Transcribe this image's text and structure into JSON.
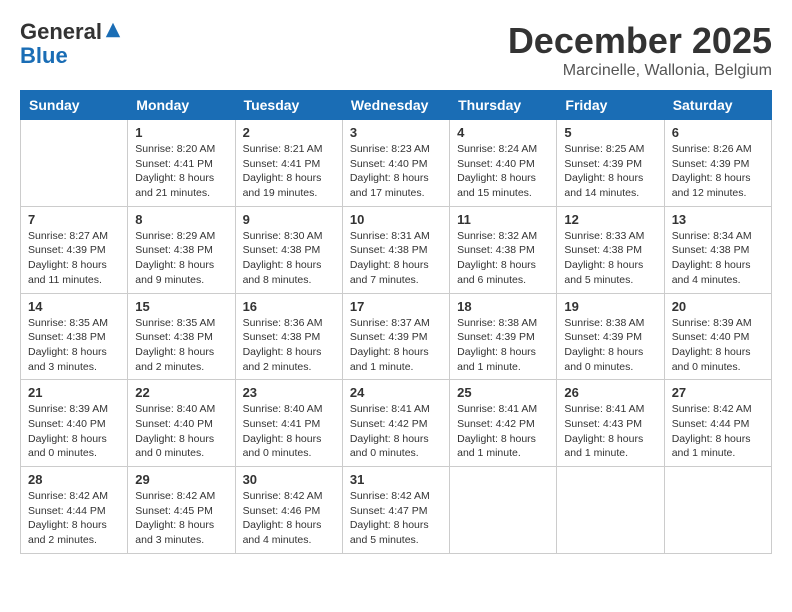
{
  "header": {
    "logo_line1": "General",
    "logo_line2": "Blue",
    "month": "December 2025",
    "location": "Marcinelle, Wallonia, Belgium"
  },
  "days_of_week": [
    "Sunday",
    "Monday",
    "Tuesday",
    "Wednesday",
    "Thursday",
    "Friday",
    "Saturday"
  ],
  "weeks": [
    [
      {
        "day": "",
        "text": ""
      },
      {
        "day": "1",
        "text": "Sunrise: 8:20 AM\nSunset: 4:41 PM\nDaylight: 8 hours\nand 21 minutes."
      },
      {
        "day": "2",
        "text": "Sunrise: 8:21 AM\nSunset: 4:41 PM\nDaylight: 8 hours\nand 19 minutes."
      },
      {
        "day": "3",
        "text": "Sunrise: 8:23 AM\nSunset: 4:40 PM\nDaylight: 8 hours\nand 17 minutes."
      },
      {
        "day": "4",
        "text": "Sunrise: 8:24 AM\nSunset: 4:40 PM\nDaylight: 8 hours\nand 15 minutes."
      },
      {
        "day": "5",
        "text": "Sunrise: 8:25 AM\nSunset: 4:39 PM\nDaylight: 8 hours\nand 14 minutes."
      },
      {
        "day": "6",
        "text": "Sunrise: 8:26 AM\nSunset: 4:39 PM\nDaylight: 8 hours\nand 12 minutes."
      }
    ],
    [
      {
        "day": "7",
        "text": "Sunrise: 8:27 AM\nSunset: 4:39 PM\nDaylight: 8 hours\nand 11 minutes."
      },
      {
        "day": "8",
        "text": "Sunrise: 8:29 AM\nSunset: 4:38 PM\nDaylight: 8 hours\nand 9 minutes."
      },
      {
        "day": "9",
        "text": "Sunrise: 8:30 AM\nSunset: 4:38 PM\nDaylight: 8 hours\nand 8 minutes."
      },
      {
        "day": "10",
        "text": "Sunrise: 8:31 AM\nSunset: 4:38 PM\nDaylight: 8 hours\nand 7 minutes."
      },
      {
        "day": "11",
        "text": "Sunrise: 8:32 AM\nSunset: 4:38 PM\nDaylight: 8 hours\nand 6 minutes."
      },
      {
        "day": "12",
        "text": "Sunrise: 8:33 AM\nSunset: 4:38 PM\nDaylight: 8 hours\nand 5 minutes."
      },
      {
        "day": "13",
        "text": "Sunrise: 8:34 AM\nSunset: 4:38 PM\nDaylight: 8 hours\nand 4 minutes."
      }
    ],
    [
      {
        "day": "14",
        "text": "Sunrise: 8:35 AM\nSunset: 4:38 PM\nDaylight: 8 hours\nand 3 minutes."
      },
      {
        "day": "15",
        "text": "Sunrise: 8:35 AM\nSunset: 4:38 PM\nDaylight: 8 hours\nand 2 minutes."
      },
      {
        "day": "16",
        "text": "Sunrise: 8:36 AM\nSunset: 4:38 PM\nDaylight: 8 hours\nand 2 minutes."
      },
      {
        "day": "17",
        "text": "Sunrise: 8:37 AM\nSunset: 4:39 PM\nDaylight: 8 hours\nand 1 minute."
      },
      {
        "day": "18",
        "text": "Sunrise: 8:38 AM\nSunset: 4:39 PM\nDaylight: 8 hours\nand 1 minute."
      },
      {
        "day": "19",
        "text": "Sunrise: 8:38 AM\nSunset: 4:39 PM\nDaylight: 8 hours\nand 0 minutes."
      },
      {
        "day": "20",
        "text": "Sunrise: 8:39 AM\nSunset: 4:40 PM\nDaylight: 8 hours\nand 0 minutes."
      }
    ],
    [
      {
        "day": "21",
        "text": "Sunrise: 8:39 AM\nSunset: 4:40 PM\nDaylight: 8 hours\nand 0 minutes."
      },
      {
        "day": "22",
        "text": "Sunrise: 8:40 AM\nSunset: 4:40 PM\nDaylight: 8 hours\nand 0 minutes."
      },
      {
        "day": "23",
        "text": "Sunrise: 8:40 AM\nSunset: 4:41 PM\nDaylight: 8 hours\nand 0 minutes."
      },
      {
        "day": "24",
        "text": "Sunrise: 8:41 AM\nSunset: 4:42 PM\nDaylight: 8 hours\nand 0 minutes."
      },
      {
        "day": "25",
        "text": "Sunrise: 8:41 AM\nSunset: 4:42 PM\nDaylight: 8 hours\nand 1 minute."
      },
      {
        "day": "26",
        "text": "Sunrise: 8:41 AM\nSunset: 4:43 PM\nDaylight: 8 hours\nand 1 minute."
      },
      {
        "day": "27",
        "text": "Sunrise: 8:42 AM\nSunset: 4:44 PM\nDaylight: 8 hours\nand 1 minute."
      }
    ],
    [
      {
        "day": "28",
        "text": "Sunrise: 8:42 AM\nSunset: 4:44 PM\nDaylight: 8 hours\nand 2 minutes."
      },
      {
        "day": "29",
        "text": "Sunrise: 8:42 AM\nSunset: 4:45 PM\nDaylight: 8 hours\nand 3 minutes."
      },
      {
        "day": "30",
        "text": "Sunrise: 8:42 AM\nSunset: 4:46 PM\nDaylight: 8 hours\nand 4 minutes."
      },
      {
        "day": "31",
        "text": "Sunrise: 8:42 AM\nSunset: 4:47 PM\nDaylight: 8 hours\nand 5 minutes."
      },
      {
        "day": "",
        "text": ""
      },
      {
        "day": "",
        "text": ""
      },
      {
        "day": "",
        "text": ""
      }
    ]
  ]
}
